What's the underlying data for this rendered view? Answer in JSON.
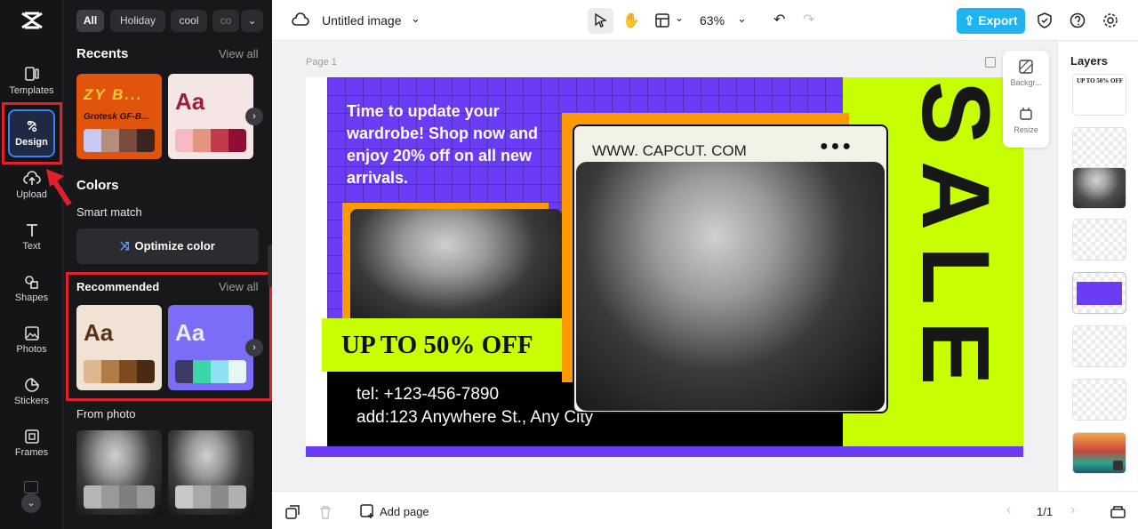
{
  "rail": {
    "items": [
      {
        "label": "Templates",
        "icon": "templates-icon"
      },
      {
        "label": "Design",
        "icon": "design-icon",
        "active": true
      },
      {
        "label": "Upload",
        "icon": "upload-icon"
      },
      {
        "label": "Text",
        "icon": "text-icon"
      },
      {
        "label": "Shapes",
        "icon": "shapes-icon"
      },
      {
        "label": "Photos",
        "icon": "photos-icon"
      },
      {
        "label": "Stickers",
        "icon": "stickers-icon"
      },
      {
        "label": "Frames",
        "icon": "frames-icon"
      }
    ]
  },
  "panel": {
    "chips": [
      "All",
      "Holiday",
      "cool",
      "co"
    ],
    "recents": {
      "title": "Recents",
      "view_all": "View all",
      "card1_text": "ZY B...",
      "card1_sub": "Grotesk GF-B...",
      "card2_text": "Aa"
    },
    "colors": {
      "title": "Colors",
      "smart_match": "Smart match",
      "optimize": "Optimize color"
    },
    "recommended": {
      "title": "Recommended",
      "view_all": "View all",
      "card1_text": "Aa",
      "card2_text": "Aa"
    },
    "from_photo": "From photo"
  },
  "topbar": {
    "doc_title": "Untitled image",
    "zoom": "63%",
    "export": "Export"
  },
  "canvas": {
    "page_label": "Page 1",
    "design": {
      "headline": "Time to update your wardrobe! Shop now and enjoy 20% off on all new arrivals.",
      "url": "WWW. CAPCUT. COM",
      "offer": "UP TO 50% OFF",
      "tel": "tel: +123-456-7890",
      "addr": "add:123 Anywhere St., Any City",
      "sale": "SALE"
    },
    "float_tools": {
      "background": "Backgr...",
      "resize": "Resize"
    }
  },
  "layers": {
    "title": "Layers",
    "first_thumb_text": "UP TO 50% OFF"
  },
  "bottombar": {
    "add_page": "Add page",
    "page_count": "1/1"
  },
  "colors": {
    "accent": "#1fb4ef",
    "purple": "#6b3cf5",
    "lime": "#c8ff00",
    "orange": "#ff9900",
    "highlight": "#e0202b"
  }
}
